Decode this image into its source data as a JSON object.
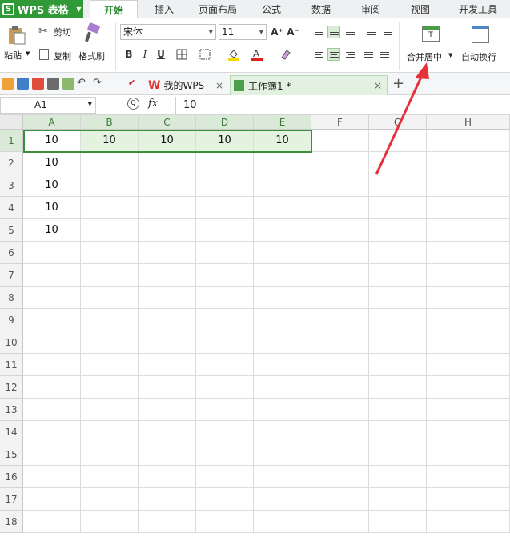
{
  "app": {
    "title": "WPS 表格",
    "logo_letter": "S"
  },
  "menu_tabs": [
    "开始",
    "插入",
    "页面布局",
    "公式",
    "数据",
    "审阅",
    "视图",
    "开发工具"
  ],
  "ribbon": {
    "paste": "粘贴",
    "cut": "剪切",
    "copy": "复制",
    "format_painter": "格式刷",
    "font_name": "宋体",
    "font_size": "11",
    "merge_center": "合并居中",
    "wrap_text": "自动换行"
  },
  "doc_tabs": {
    "home": "我的WPS",
    "workbook": "工作簿1 *"
  },
  "formula_bar": {
    "cell_ref": "A1",
    "fx": "fx",
    "value": "10"
  },
  "sheet": {
    "columns": [
      "A",
      "B",
      "C",
      "D",
      "E",
      "F",
      "G",
      "H"
    ],
    "rows": [
      "1",
      "2",
      "3",
      "4",
      "5",
      "6",
      "7",
      "8",
      "9",
      "10",
      "11",
      "12",
      "13",
      "14",
      "15",
      "16",
      "17",
      "18"
    ],
    "cells": [
      [
        "10",
        "10",
        "10",
        "10",
        "10"
      ],
      [
        "10"
      ],
      [
        "10"
      ],
      [
        "10"
      ],
      [
        "10"
      ]
    ]
  },
  "colors": {
    "brand_green": "#2f9a36",
    "selection_border": "#3c8f3a",
    "annotation_arrow": "#e8303a"
  }
}
